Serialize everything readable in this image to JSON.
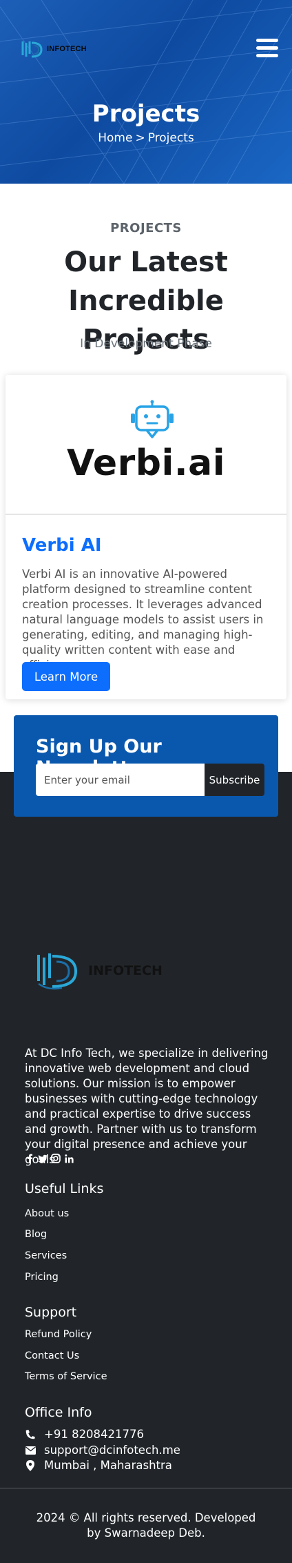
{
  "header": {
    "logo_text": "INFOTECH",
    "page_title": "Projects",
    "breadcrumb": {
      "home": "Home",
      "separator": ">",
      "current": "Projects"
    }
  },
  "section": {
    "eyebrow": "PROJECTS",
    "headline": "Our Latest Incredible Projects",
    "subline": "In Development Phase"
  },
  "project": {
    "brand": "Verbi.ai",
    "title": "Verbi AI",
    "description": "Verbi AI is an innovative AI-powered platform designed to streamline content creation processes. It leverages advanced natural language models to assist users in generating, editing, and managing high-quality written content with ease and efficiency.",
    "button_label": "Learn More"
  },
  "newsletter": {
    "title": "Sign Up Our Newsletter",
    "placeholder": "Enter your email",
    "button_label": "Subscribe"
  },
  "footer": {
    "logo_text": "INFOTECH",
    "about": "At DC Info Tech, we specialize in delivering innovative web development and cloud solutions. Our mission is to empower businesses with cutting-edge technology and practical expertise to drive success and growth. Partner with us to transform your digital presence and achieve your goals.",
    "socials": [
      "facebook-icon",
      "twitter-icon",
      "instagram-icon",
      "linkedin-icon"
    ],
    "useful_links": {
      "heading": "Useful Links",
      "items": [
        "About us",
        "Blog",
        "Services",
        "Pricing"
      ]
    },
    "support": {
      "heading": "Support",
      "items": [
        "Refund Policy",
        "Contact Us",
        "Terms of Service"
      ]
    },
    "office": {
      "heading": "Office Info",
      "phone": "+91 8208421776",
      "email": "support@dcinfotech.me",
      "location": "Mumbai , Maharashtra"
    },
    "copyright": "2024 © All rights reserved. Developed by Swarnadeep Deb."
  },
  "colors": {
    "primary": "#0d6efd",
    "hero_blue": "#0e4aa0",
    "newsletter_blue": "#0a58ae",
    "footer_dark": "#212529",
    "logo_cyan": "#2aa8d8"
  }
}
